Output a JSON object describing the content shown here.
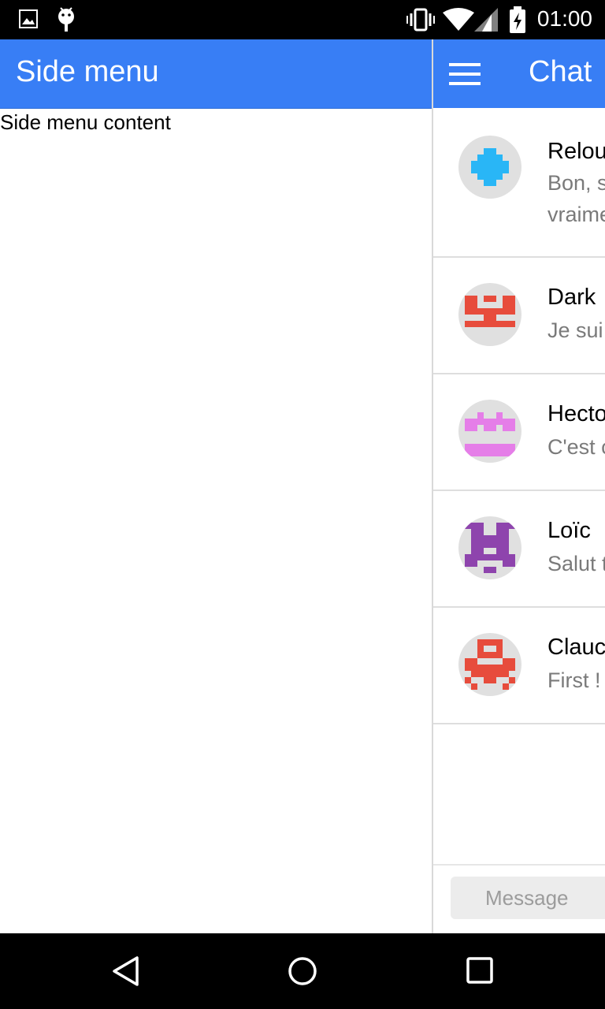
{
  "status_bar": {
    "time": "01:00",
    "icons": [
      "image-icon",
      "android-icon",
      "vibrate-icon",
      "wifi-icon",
      "signal-icon",
      "battery-charging-icon"
    ]
  },
  "side_menu": {
    "title": "Side menu",
    "content": "Side menu content"
  },
  "chat": {
    "title": "Chat",
    "menu_icon": "hamburger-menu-icon",
    "conversations": [
      {
        "name": "Relou",
        "preview_line1": "Bon, s",
        "preview_line2": "vraime",
        "avatar_color": "#29b6f6"
      },
      {
        "name": "Dark ",
        "preview_line1": "Je sui",
        "avatar_color": "#e74c3c"
      },
      {
        "name": "Hecto",
        "preview_line1": "C'est c",
        "avatar_color": "#e57ee8"
      },
      {
        "name": "Loïc ",
        "preview_line1": "Salut t",
        "avatar_color": "#8e44ad"
      },
      {
        "name": "Clauc",
        "preview_line1": "First !",
        "avatar_color": "#e74c3c"
      }
    ],
    "message_input": {
      "placeholder": "Message"
    }
  },
  "nav_bar": {
    "icons": [
      "back-icon",
      "home-icon",
      "recents-icon"
    ]
  },
  "colors": {
    "header": "#387ef5",
    "status_bar": "#000000"
  }
}
